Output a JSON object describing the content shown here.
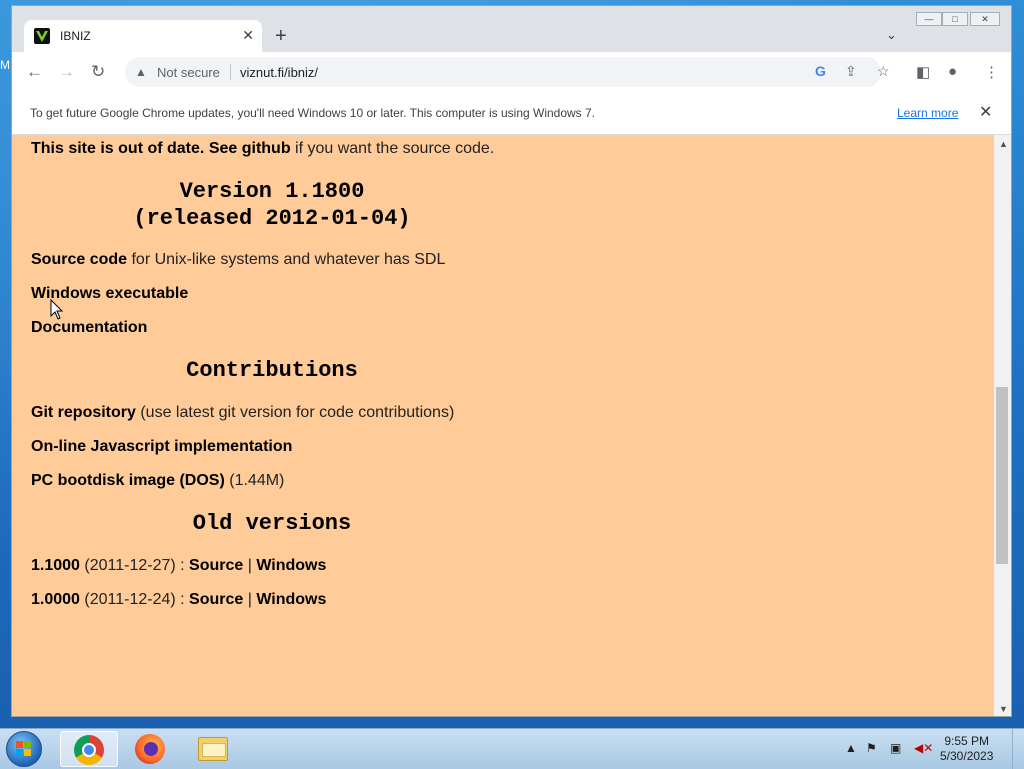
{
  "desktop": {
    "edge_letter": "M"
  },
  "browser": {
    "tab": {
      "title": "IBNIZ"
    },
    "address": {
      "security_label": "Not secure",
      "url": "viznut.fi/ibniz/"
    },
    "infobar": {
      "message": "To get future Google Chrome updates, you'll need Windows 10 or later. This computer is using Windows 7.",
      "learn_more": "Learn more"
    }
  },
  "page": {
    "intro": {
      "bold1": "This site is out of date.",
      "bold2": "See github",
      "rest": " if you want the source code."
    },
    "version_heading": "Version 1.1800",
    "release_heading": "(released 2012-01-04)",
    "source": {
      "link": "Source code",
      "rest": " for Unix-like systems and whatever has SDL"
    },
    "windows_exe": "Windows executable",
    "documentation": "Documentation",
    "contributions_heading": "Contributions",
    "git": {
      "link": "Git repository",
      "rest": " (use latest git version for code contributions)"
    },
    "js_impl": "On-line Javascript implementation",
    "bootdisk": {
      "link": "PC bootdisk image (DOS)",
      "rest": " (1.44M)"
    },
    "old_heading": "Old versions",
    "old_versions": [
      {
        "version": "1.1000",
        "date": " (2011-12-27) : ",
        "source": "Source",
        "sep": " | ",
        "windows": "Windows"
      },
      {
        "version": "1.0000",
        "date": " (2011-12-24) : ",
        "source": "Source",
        "sep": " | ",
        "windows": "Windows"
      }
    ]
  },
  "taskbar": {
    "time": "9:55 PM",
    "date": "5/30/2023"
  },
  "colors": {
    "page_bg": "#ffcc99",
    "link": "#000000",
    "learn_more": "#1a73e8"
  },
  "icons": [
    "chrome-icon",
    "firefox-icon",
    "file-explorer-icon",
    "windows-start-icon",
    "warning-icon",
    "google-icon",
    "share-icon",
    "star-icon",
    "side-panel-icon",
    "profile-icon",
    "kebab-menu-icon"
  ]
}
